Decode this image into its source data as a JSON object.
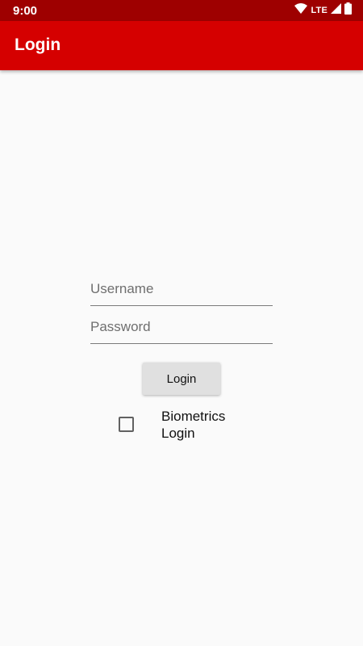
{
  "status_bar": {
    "time": "9:00",
    "network": "LTE",
    "icons": [
      "wifi-icon",
      "signal-icon",
      "battery-icon"
    ]
  },
  "app_bar": {
    "title": "Login"
  },
  "form": {
    "username": {
      "placeholder": "Username",
      "value": ""
    },
    "password": {
      "placeholder": "Password",
      "value": ""
    },
    "login_label": "Login",
    "biometrics_label": "Biometrics Login",
    "biometrics_checked": false
  },
  "colors": {
    "status_bar": "#9e0000",
    "app_bar": "#d50000",
    "background": "#fafafa",
    "button": "#e0e0e0"
  }
}
